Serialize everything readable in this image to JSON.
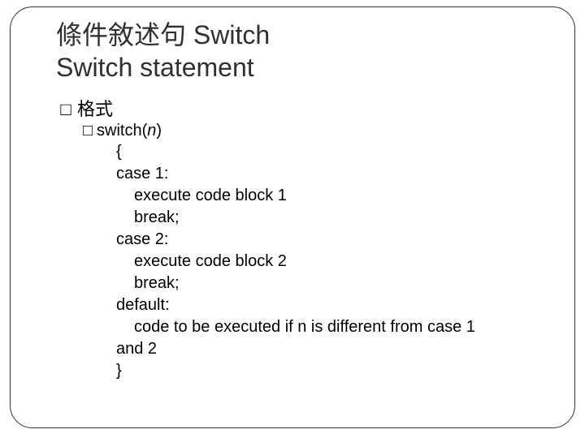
{
  "title": {
    "line1": "條件敘述句 Switch",
    "line2": "Switch statement"
  },
  "bullets": {
    "glyph": "□",
    "lvl1_label": "格式",
    "lvl2_prefix": "switch(",
    "lvl2_var": "n",
    "lvl2_suffix": ")"
  },
  "code": {
    "l1": "{",
    "l2": "case 1:",
    "l3": "execute code block 1",
    "l4": "break;",
    "l5": "case 2:",
    "l6": "execute code block 2",
    "l7": "break;",
    "l8": "default:",
    "l9": "code to be executed if n is different from case 1",
    "l10": "and 2",
    "l11": "}"
  }
}
